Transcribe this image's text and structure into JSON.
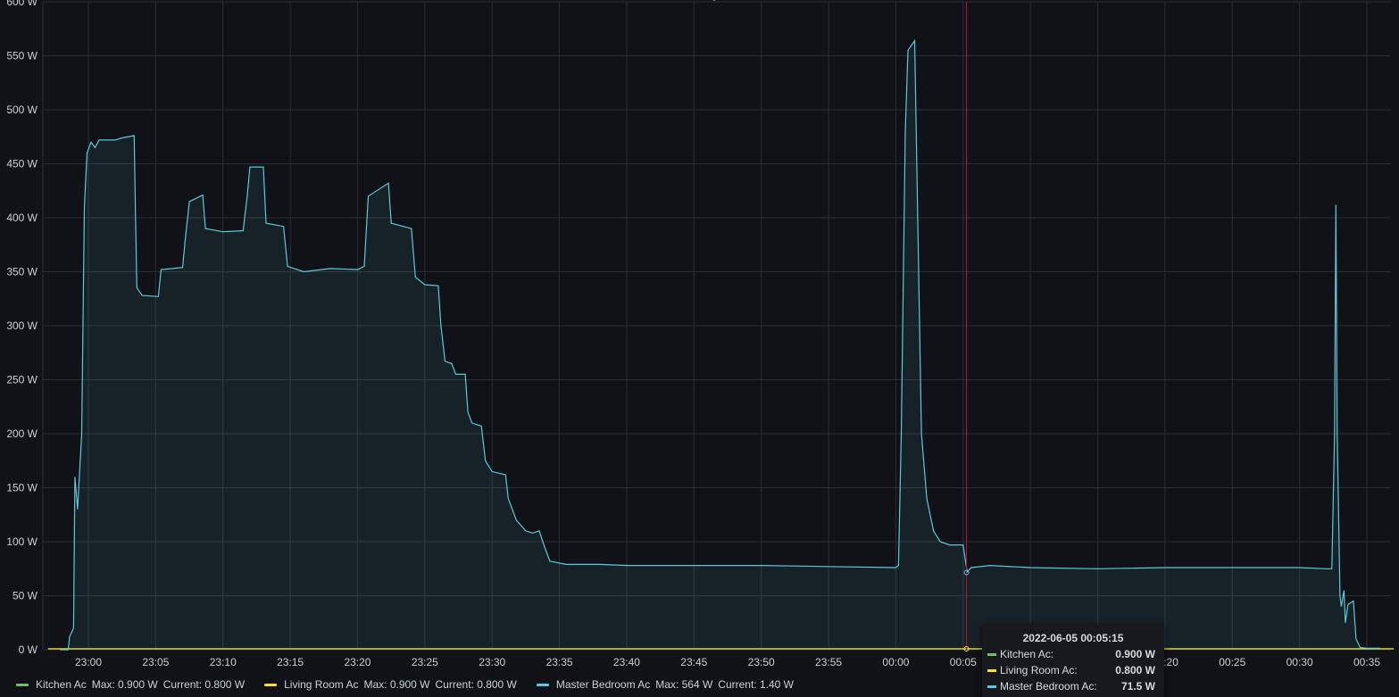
{
  "chart_data": {
    "type": "area",
    "y_unit": "W",
    "ylim": [
      0,
      600
    ],
    "y_ticks": [
      "0 W",
      "50 W",
      "100 W",
      "150 W",
      "200 W",
      "250 W",
      "300 W",
      "350 W",
      "400 W",
      "450 W",
      "500 W",
      "550 W",
      "600 W"
    ],
    "x_range": [
      "22:57",
      "00:37"
    ],
    "x_ticks": [
      "23:00",
      "23:05",
      "23:10",
      "23:15",
      "23:20",
      "23:25",
      "23:30",
      "23:35",
      "23:40",
      "23:45",
      "23:50",
      "23:55",
      "00:00",
      "00:05",
      "00:10",
      "00:15",
      "00:20",
      "00:25",
      "00:30",
      "00:35"
    ],
    "grid": true,
    "series": [
      {
        "name": "Kitchen Ac",
        "color": "#73bf69",
        "points": [
          [
            "22:57",
            0.8
          ],
          [
            "00:37",
            0.8
          ]
        ]
      },
      {
        "name": "Living Room Ac",
        "color": "#fade2a",
        "points": [
          [
            "22:57",
            0.8
          ],
          [
            "00:37",
            0.8
          ]
        ]
      },
      {
        "name": "Master Bedroom Ac",
        "color": "#5cc8db",
        "points": [
          [
            "22:57.9",
            0
          ],
          [
            "22:58.5",
            0
          ],
          [
            "22:58.6",
            12
          ],
          [
            "22:58.9",
            20
          ],
          [
            "22:59.0",
            160
          ],
          [
            "22:59.2",
            130
          ],
          [
            "22:59.5",
            200
          ],
          [
            "22:59.7",
            410
          ],
          [
            "22:59.9",
            460
          ],
          [
            "23:00.2",
            470
          ],
          [
            "23:00.5",
            465
          ],
          [
            "23:00.8",
            472
          ],
          [
            "23:02.0",
            472
          ],
          [
            "23:02.5",
            474
          ],
          [
            "23:03.4",
            476
          ],
          [
            "23:03.5",
            400
          ],
          [
            "23:03.6",
            335
          ],
          [
            "23:04.0",
            328
          ],
          [
            "23:05.2",
            327
          ],
          [
            "23:05.4",
            352
          ],
          [
            "23:07.0",
            354
          ],
          [
            "23:07.2",
            380
          ],
          [
            "23:07.5",
            415
          ],
          [
            "23:08.5",
            421
          ],
          [
            "23:08.7",
            390
          ],
          [
            "23:10.0",
            387
          ],
          [
            "23:11.5",
            388
          ],
          [
            "23:11.8",
            420
          ],
          [
            "23:12.0",
            447
          ],
          [
            "23:13.0",
            447
          ],
          [
            "23:13.2",
            395
          ],
          [
            "23:14.5",
            392
          ],
          [
            "23:14.8",
            355
          ],
          [
            "23:16.0",
            350
          ],
          [
            "23:18.0",
            353
          ],
          [
            "23:20.0",
            352
          ],
          [
            "23:20.5",
            355
          ],
          [
            "23:20.8",
            420
          ],
          [
            "23:22.3",
            432
          ],
          [
            "23:22.5",
            395
          ],
          [
            "23:24.0",
            390
          ],
          [
            "23:24.3",
            345
          ],
          [
            "23:25.0",
            338
          ],
          [
            "23:26.0",
            337
          ],
          [
            "23:26.2",
            300
          ],
          [
            "23:26.5",
            267
          ],
          [
            "23:27.0",
            265
          ],
          [
            "23:27.3",
            255
          ],
          [
            "23:28.0",
            255
          ],
          [
            "23:28.2",
            220
          ],
          [
            "23:28.5",
            210
          ],
          [
            "23:29.2",
            207
          ],
          [
            "23:29.5",
            175
          ],
          [
            "23:30.0",
            165
          ],
          [
            "23:31.0",
            162
          ],
          [
            "23:31.2",
            140
          ],
          [
            "23:31.8",
            120
          ],
          [
            "23:32.5",
            110
          ],
          [
            "23:33.0",
            108
          ],
          [
            "23:33.5",
            110
          ],
          [
            "23:33.9",
            95
          ],
          [
            "23:34.3",
            82
          ],
          [
            "23:35.5",
            79
          ],
          [
            "23:38.0",
            79
          ],
          [
            "23:40.0",
            78
          ],
          [
            "23:45.0",
            78
          ],
          [
            "23:50.0",
            78
          ],
          [
            "23:55.0",
            77
          ],
          [
            "00:00.0",
            76
          ],
          [
            "00:00.2",
            78
          ],
          [
            "00:00.4",
            200
          ],
          [
            "00:00.7",
            480
          ],
          [
            "00:00.9",
            555
          ],
          [
            "00:01.4",
            564
          ],
          [
            "00:01.6",
            420
          ],
          [
            "00:01.9",
            200
          ],
          [
            "00:02.3",
            140
          ],
          [
            "00:02.8",
            110
          ],
          [
            "00:03.3",
            100
          ],
          [
            "00:04.0",
            97
          ],
          [
            "00:05.0",
            97
          ],
          [
            "00:05.3",
            72
          ],
          [
            "00:05.6",
            76
          ],
          [
            "00:07.0",
            78
          ],
          [
            "00:10.0",
            76
          ],
          [
            "00:15.0",
            75
          ],
          [
            "00:20.0",
            76
          ],
          [
            "00:25.0",
            76
          ],
          [
            "00:30.0",
            76
          ],
          [
            "00:32.0",
            75
          ],
          [
            "00:32.4",
            75
          ],
          [
            "00:32.6",
            200
          ],
          [
            "00:32.7",
            412
          ],
          [
            "00:32.8",
            200
          ],
          [
            "00:33.0",
            50
          ],
          [
            "00:33.1",
            40
          ],
          [
            "00:33.3",
            55
          ],
          [
            "00:33.4",
            25
          ],
          [
            "00:33.6",
            42
          ],
          [
            "00:34.0",
            45
          ],
          [
            "00:34.2",
            10
          ],
          [
            "00:34.5",
            2
          ],
          [
            "00:35.0",
            1.4
          ],
          [
            "00:36.0",
            1.4
          ]
        ]
      }
    ]
  },
  "cursor_time": "00:05:15",
  "legend": [
    {
      "name": "Kitchen Ac",
      "max": "Max: 0.900 W",
      "current": "Current: 0.800 W",
      "color": "#73bf69"
    },
    {
      "name": "Living Room Ac",
      "max": "Max: 0.900 W",
      "current": "Current: 0.800 W",
      "color": "#fade2a"
    },
    {
      "name": "Master Bedroom Ac",
      "max": "Max: 564 W",
      "current": "Current: 1.40 W",
      "color": "#5cc8db"
    }
  ],
  "tooltip": {
    "time": "2022-06-05 00:05:15",
    "rows": [
      {
        "label": "Kitchen Ac:",
        "value": "0.900 W",
        "color": "#73bf69"
      },
      {
        "label": "Living Room Ac:",
        "value": "0.800 W",
        "color": "#fade2a"
      },
      {
        "label": "Master Bedroom Ac:",
        "value": "71.5 W",
        "color": "#5cc8db"
      }
    ]
  },
  "panel": {
    "collapse_icon": "chevron-down-icon",
    "collapse_glyph": "⌄"
  }
}
